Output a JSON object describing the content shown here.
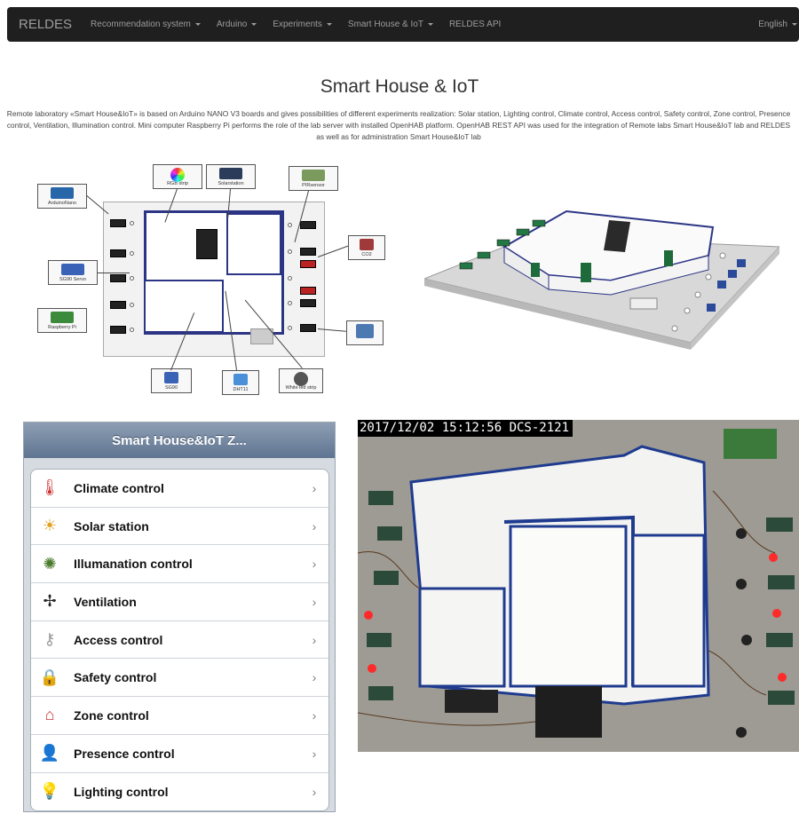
{
  "nav": {
    "brand": "RELDES",
    "items": [
      {
        "label": "Recommendation system",
        "dropdown": true
      },
      {
        "label": "Arduino",
        "dropdown": true
      },
      {
        "label": "Experiments",
        "dropdown": true
      },
      {
        "label": "Smart House & IoT",
        "dropdown": true
      },
      {
        "label": "RELDES API",
        "dropdown": false
      }
    ],
    "language": "English"
  },
  "page": {
    "title": "Smart House & IoT",
    "intro": "Remote laboratory «Smart House&IoT» is based on Arduino NANO V3 boards and gives possibilities of different experiments realization: Solar station, Lighting control, Climate control, Access control, Safety control, Zone control, Presence control, Ventilation, Illumination control. Mini computer Raspberry Pi performs the role of the lab server with installed OpenHAB platform. OpenHAB REST API was used for the integration of Remote labs Smart House&IoT lab and RELDES as well as for administration Smart House&IoT lab"
  },
  "schematic": {
    "labels": {
      "arduino_nano": "ArduinoNano",
      "rgb_strip": "RGB strip",
      "solar_station": "Solarstation",
      "pir_sensor": "PIRsensor",
      "sg90_servo": "SG90 Servo",
      "co2": "CO2",
      "raspberry_pi": "Raspberry Pi",
      "cooler": "",
      "servo_bottom": "SG90",
      "dht11": "DHT11",
      "white_led": "White led strip"
    }
  },
  "menu": {
    "title": "Smart House&IoT Z...",
    "items": [
      {
        "label": "Climate control",
        "icon": "thermometer-icon",
        "glyph": "🌡"
      },
      {
        "label": "Solar station",
        "icon": "solar-panel-icon",
        "glyph": "☀"
      },
      {
        "label": "Illumanation control",
        "icon": "lightbulb-rays-icon",
        "glyph": "✺"
      },
      {
        "label": "Ventilation",
        "icon": "fan-icon",
        "glyph": "✢"
      },
      {
        "label": "Access control",
        "icon": "key-icon",
        "glyph": "⚷"
      },
      {
        "label": "Safety control",
        "icon": "padlock-icon",
        "glyph": "🔒"
      },
      {
        "label": "Zone control",
        "icon": "zone-icon",
        "glyph": "⌂"
      },
      {
        "label": "Presence control",
        "icon": "person-icon",
        "glyph": "👤"
      },
      {
        "label": "Lighting control",
        "icon": "bulb-icon",
        "glyph": "💡"
      }
    ],
    "chevron": "›"
  },
  "camera": {
    "timestamp": "2017/12/02 15:12:56 DCS-2121"
  },
  "colors": {
    "navbar": "#1f1f1f",
    "nav_text": "#9d9d9d",
    "wall_blue": "#2c3585",
    "menu_header": "#6d819c"
  }
}
